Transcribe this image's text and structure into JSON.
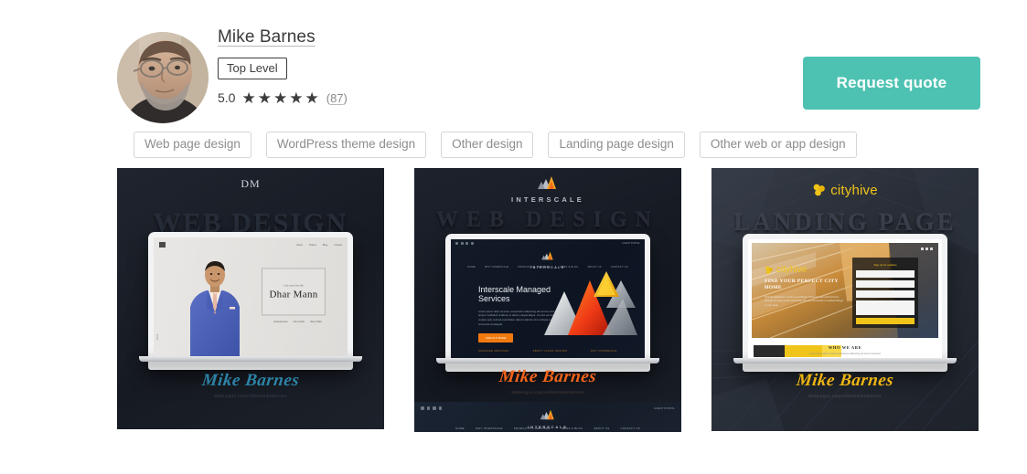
{
  "profile": {
    "avatar_alt": "Mike Barnes profile photo",
    "name": "Mike Barnes",
    "level_badge": "Top Level",
    "rating_score": "5.0",
    "stars_count": 5,
    "star_glyph": "★",
    "review_count_open": "(",
    "review_count": "87",
    "review_count_close": ")"
  },
  "actions": {
    "request_quote": "Request quote",
    "quote_button_color": "#4ec2b2"
  },
  "tags": [
    "Web page design",
    "WordPress theme design",
    "Other design",
    "Landing page design",
    "Other web or app design"
  ],
  "portfolio": [
    {
      "brand": "DM",
      "emboss": "WEB DESIGN",
      "signature": "Mike Barnes",
      "signature_url": "99designs.ca/profiles/mikebarnes",
      "signature_color": "#2c83a6",
      "background_color": "#191d26",
      "screen": {
        "nav_links": [
          "About",
          "Videos",
          "Blog",
          "Contact"
        ],
        "tagline": "Live your best life",
        "title": "Dhar Mann",
        "subtitles": [
          "Entrepreneur",
          "Life Coach",
          "Story Teller"
        ],
        "side_label": "Scroll"
      }
    },
    {
      "brand": "INTERSCALE",
      "emboss": "WEB DESIGN",
      "signature": "Mike Barnes",
      "signature_url": "99designs.ca/profiles/mikebarnes",
      "signature_color": "#f2641b",
      "background_color": "#13171f",
      "screen": {
        "client_login": "CLIENT PORTAL",
        "logo_name": "INTERSCALE",
        "menu": [
          "HOME",
          "WHY INTERSCALE",
          "PRODUCTS & SERVICES",
          "NEWS & BLOG",
          "ABOUT US",
          "CONTACT US"
        ],
        "heading": "Interscale Managed Services",
        "body": "Lorem ipsum dolor sit amet, consectetur adipiscing elit sed do eiusmod tempor incididunt ut labore et dolore magna aliqua. Ut enim ad minim veniam quis nostrud exercitation ullamco laboris nisi ut aliquip ex ea commodo consequat.",
        "cta": "FIND OUT MORE",
        "footer_links": [
          "MANAGED SERVICES",
          "ABOUT CLOUD HOSTED",
          "WHY INTERSCALE"
        ]
      },
      "strip": {
        "client_login": "CLIENT PORTAL",
        "logo_name": "INTERSCALE",
        "menu": [
          "HOME",
          "WHY INTERSCALE",
          "PRODUCTS & SERVICES",
          "NEWS & BLOG",
          "ABOUT US",
          "CONTACT US"
        ]
      }
    },
    {
      "brand": "cityhive",
      "emboss": "LANDING PAGE",
      "signature": "Mike Barnes",
      "signature_url": "99designs.ca/profiles/mikebarnes",
      "signature_color": "#eeb513",
      "background_color": "#2a303a",
      "screen": {
        "brand": "cityhive",
        "heading": "FIND YOUR PERFECT CITY HOME",
        "body": "Find the apartment, condo or exchange. Discover your perfect home through an easy search and listing. Browse thousands of verified listings in your area.",
        "form_title": "Sign up for updates",
        "form_fields": [
          "Name",
          "Email",
          "City",
          "Comments"
        ],
        "form_submit": "Sign Up",
        "who_title": "WHO WE ARE",
        "who_body": "Lorem ipsum dolor sit amet consectetur adipiscing elit sed do eiusmod.",
        "swatch_colors": [
          "#2b2b2b",
          "#f0c419",
          "#f7d84b"
        ]
      }
    }
  ]
}
